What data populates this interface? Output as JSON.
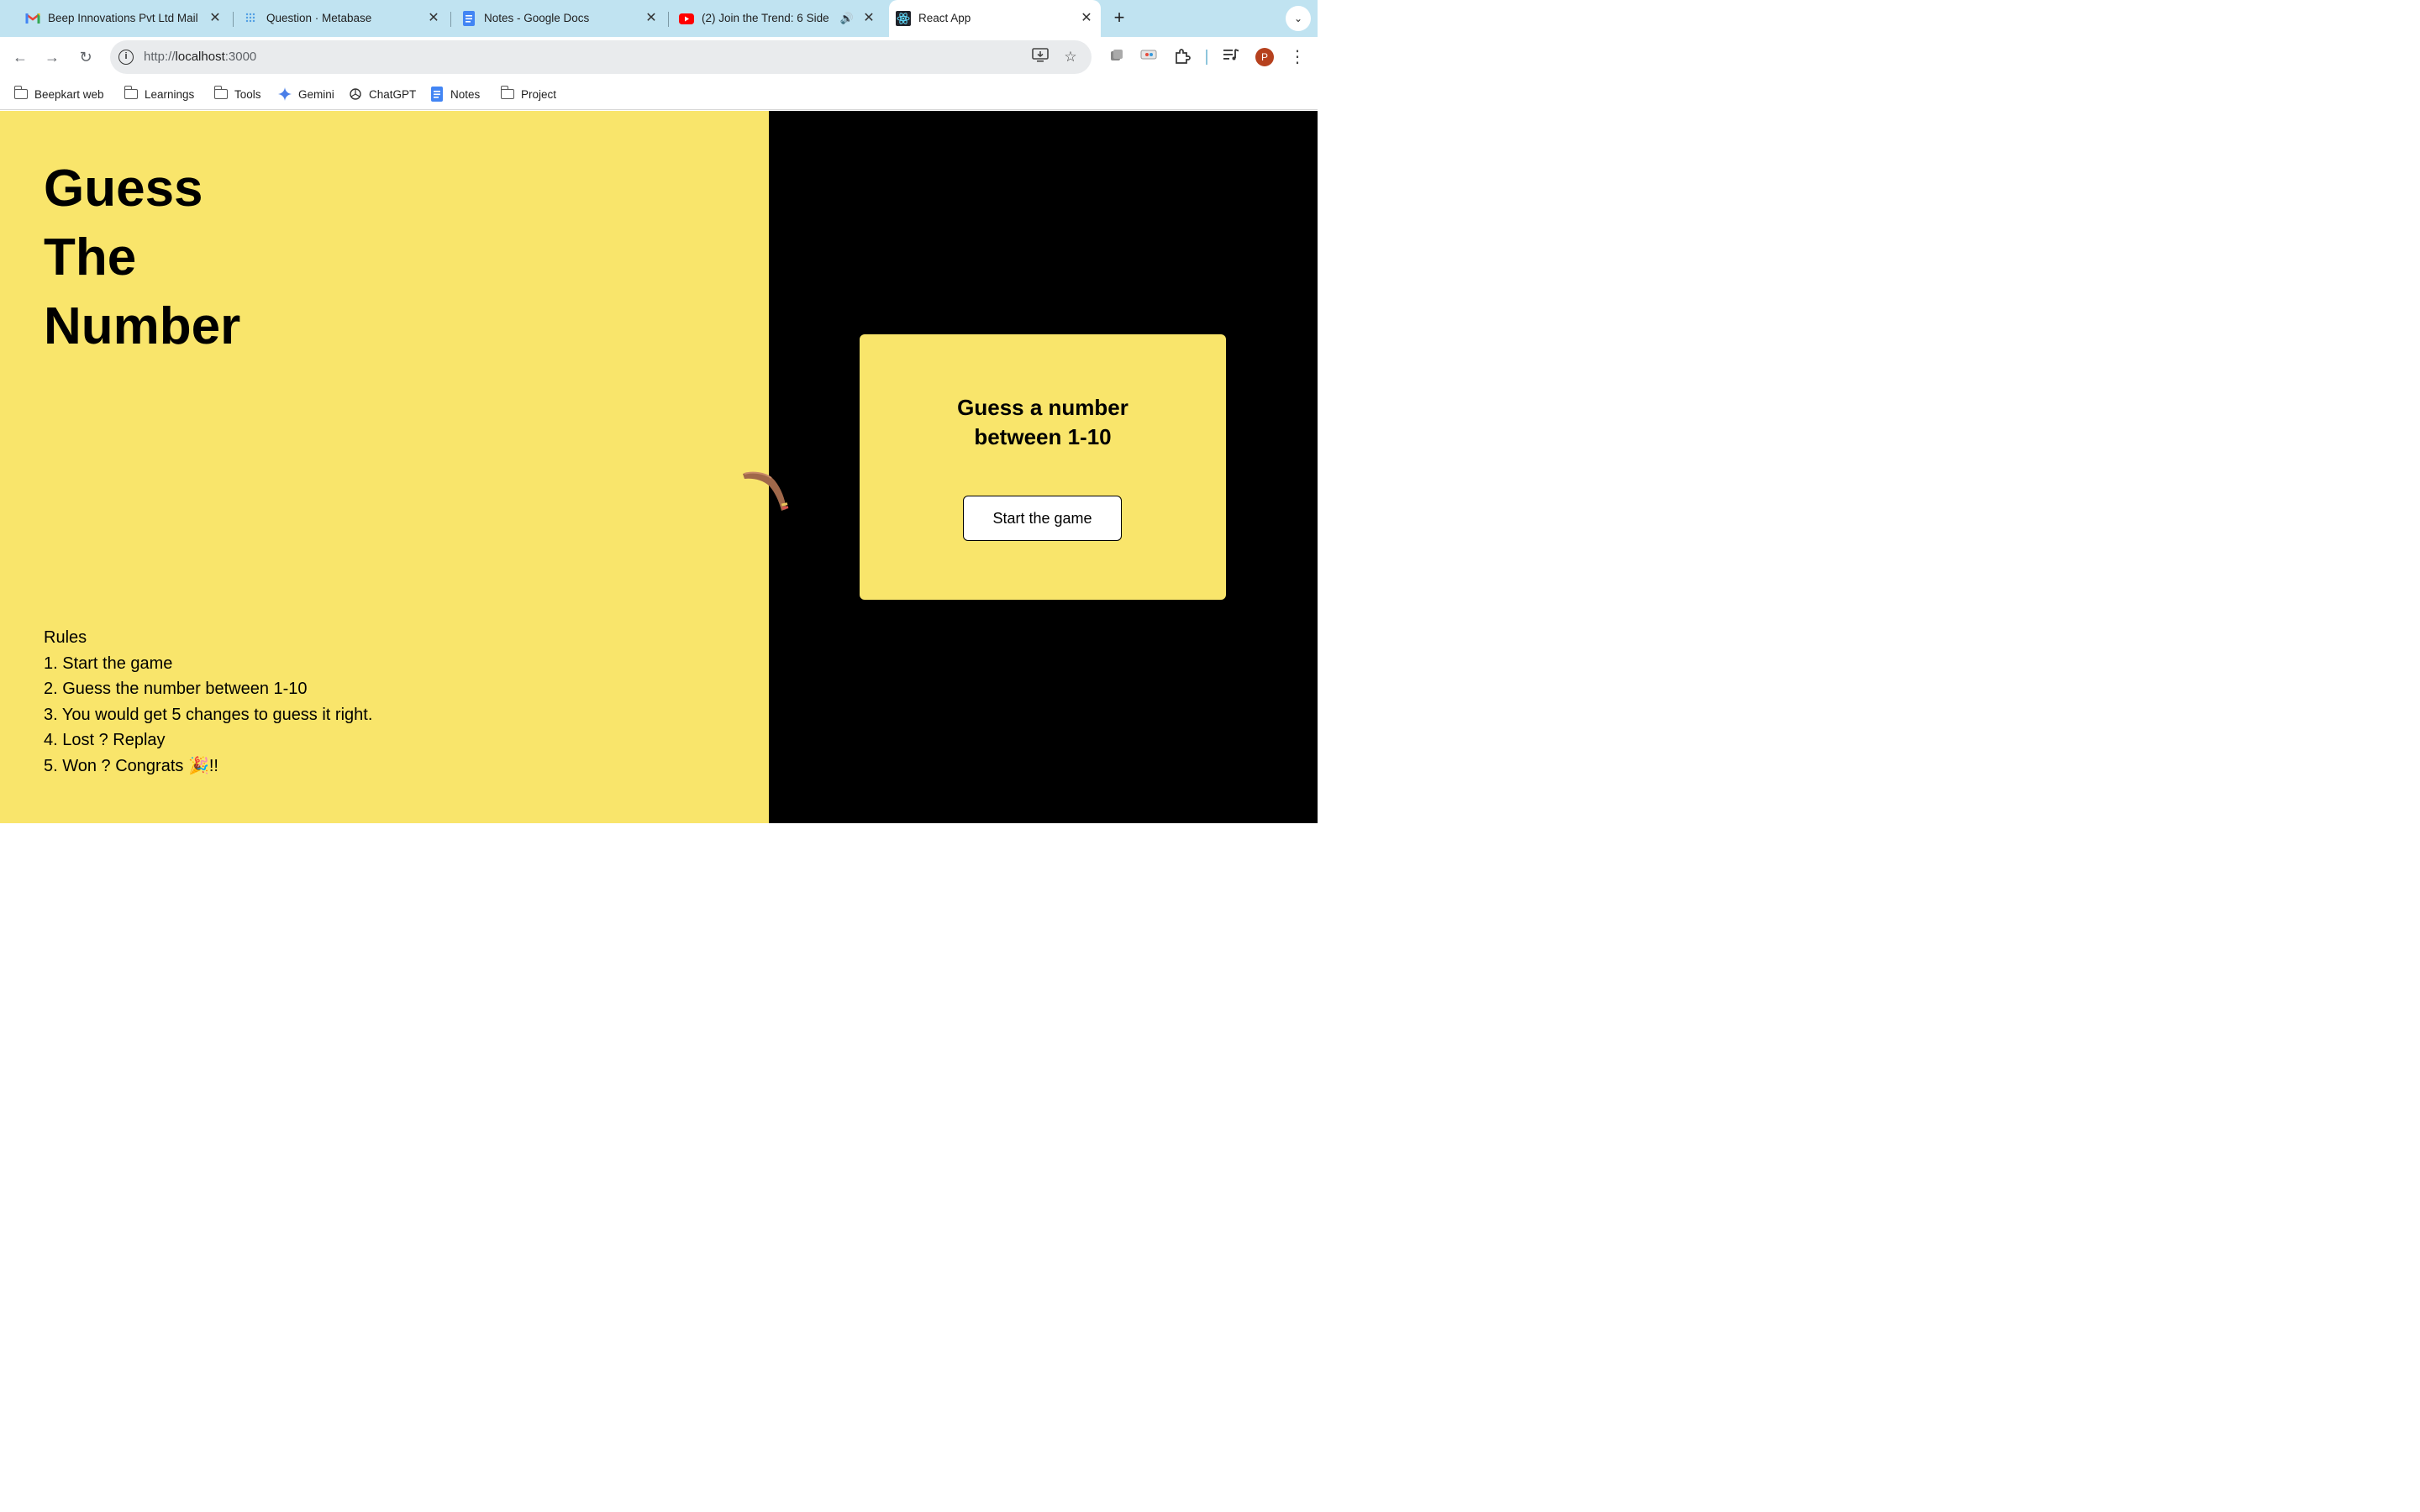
{
  "browser": {
    "tabs": [
      {
        "title": "Beep Innovations Pvt Ltd Mail",
        "icon": "gmail-icon"
      },
      {
        "title": "Question · Metabase",
        "icon": "metabase-icon"
      },
      {
        "title": "Notes - Google Docs",
        "icon": "google-docs-icon"
      },
      {
        "title": "(2) Join the Trend: 6 Side",
        "icon": "youtube-icon"
      },
      {
        "title": "React App",
        "icon": "react-icon"
      }
    ],
    "active_tab": "React App",
    "url_scheme": "http://",
    "url_host": "localhost",
    "url_port": ":3000",
    "profile_initial": "P",
    "bookmarks": [
      {
        "label": "Beepkart web",
        "icon": "folder-icon"
      },
      {
        "label": "Learnings",
        "icon": "folder-icon"
      },
      {
        "label": "Tools",
        "icon": "folder-icon"
      },
      {
        "label": "Gemini",
        "icon": "gemini-icon"
      },
      {
        "label": "ChatGPT",
        "icon": "chatgpt-icon"
      },
      {
        "label": "Notes",
        "icon": "google-docs-icon"
      },
      {
        "label": "Project",
        "icon": "folder-icon"
      }
    ]
  },
  "app": {
    "hero": [
      "Guess",
      "The",
      "Number"
    ],
    "rules_title": "Rules",
    "rules": [
      "1. Start the game",
      "2. Guess the number between 1-10",
      "3. You would get 5 changes to guess it right.",
      "4. Lost ? Replay",
      "5. Won ? Congrats 🎉!!"
    ],
    "card_title_line1": "Guess a number",
    "card_title_line2": "between 1-10",
    "start_button": "Start the game"
  },
  "colors": {
    "panel_yellow": "#f9e56b",
    "panel_black": "#000000",
    "tabstrip": "#c0e3f1"
  }
}
